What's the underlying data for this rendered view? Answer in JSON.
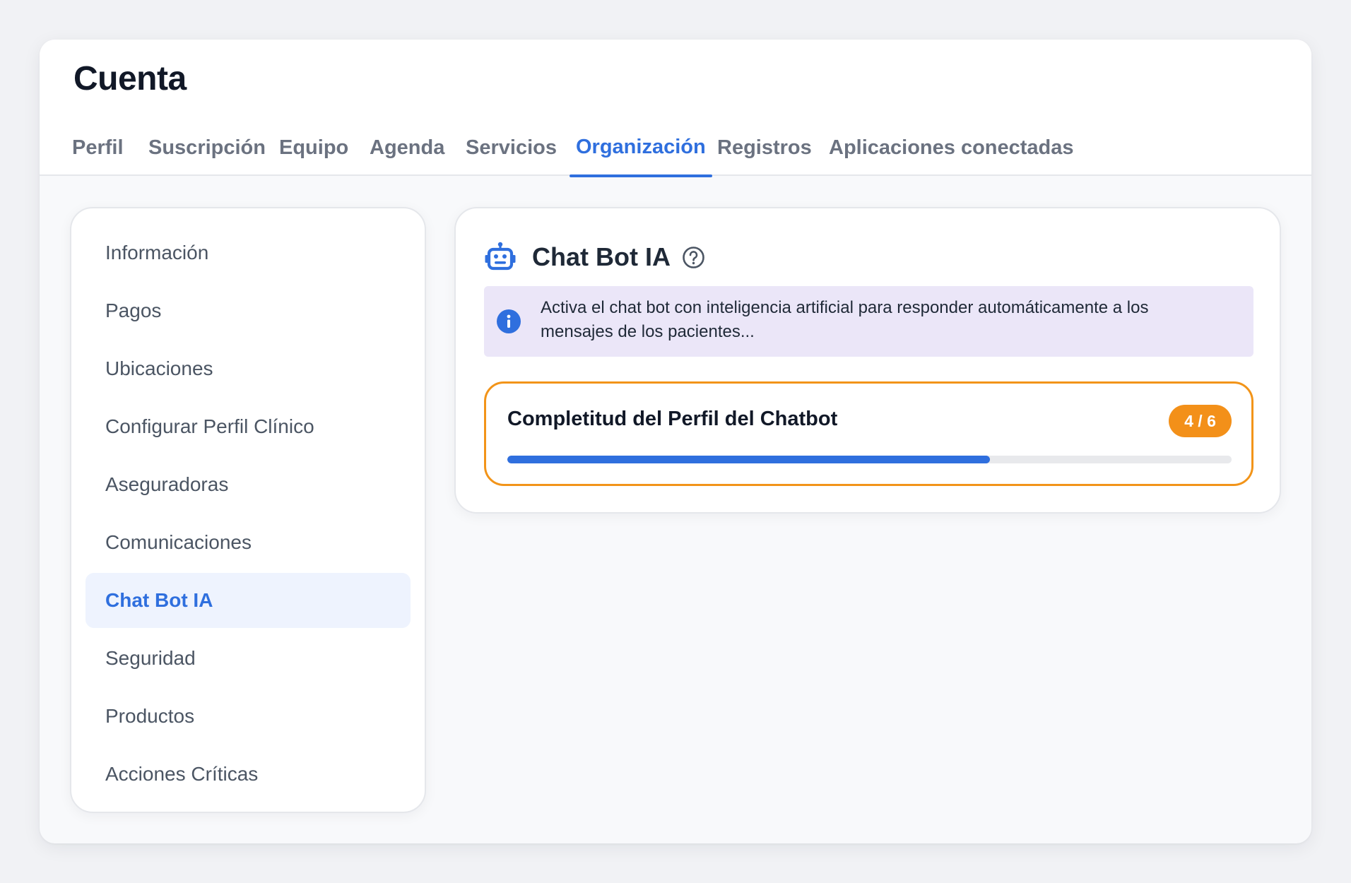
{
  "header": {
    "title": "Cuenta",
    "tabs": [
      {
        "label": "Perfil",
        "active": false
      },
      {
        "label": "Suscripción",
        "active": false
      },
      {
        "label": "Equipo",
        "active": false
      },
      {
        "label": "Agenda",
        "active": false
      },
      {
        "label": "Servicios",
        "active": false
      },
      {
        "label": "Organización",
        "active": true
      },
      {
        "label": "Registros",
        "active": false
      },
      {
        "label": "Aplicaciones conectadas",
        "active": false
      }
    ]
  },
  "sidebar": {
    "items": [
      {
        "label": "Información",
        "active": false
      },
      {
        "label": "Pagos",
        "active": false
      },
      {
        "label": "Ubicaciones",
        "active": false
      },
      {
        "label": "Configurar Perfil Clínico",
        "active": false
      },
      {
        "label": "Aseguradoras",
        "active": false
      },
      {
        "label": "Comunicaciones",
        "active": false
      },
      {
        "label": "Chat Bot IA",
        "active": true
      },
      {
        "label": "Seguridad",
        "active": false
      },
      {
        "label": "Productos",
        "active": false
      },
      {
        "label": "Acciones Críticas",
        "active": false
      }
    ]
  },
  "card": {
    "icon": "robot-icon",
    "title": "Chat Bot IA",
    "help_icon": "help-circle-icon",
    "info": {
      "icon": "info-icon",
      "text": "Activa el chat bot con inteligencia artificial para responder automáticamente a los mensajes de los pacientes..."
    },
    "progress": {
      "title": "Completitud del Perfil del Chatbot",
      "badge": "4 / 6",
      "completed": 4,
      "total": 6
    }
  },
  "colors": {
    "accent": "#2f6fde",
    "badge": "#f39019",
    "progress_border": "#f29419",
    "info_bg": "#ebe6f8"
  }
}
